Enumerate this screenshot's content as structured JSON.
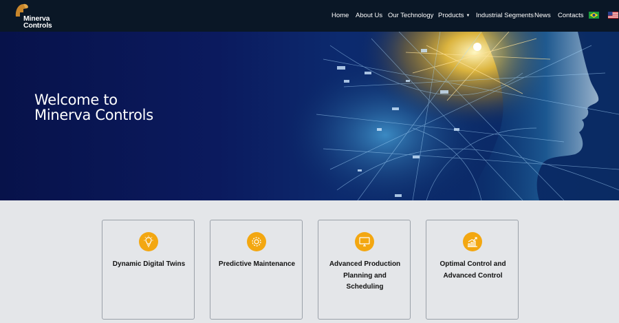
{
  "brand": {
    "line1": "Minerva",
    "line2": "Controls"
  },
  "nav": {
    "items": [
      {
        "label": "Home"
      },
      {
        "label": "About Us"
      },
      {
        "label": "Our Technology"
      },
      {
        "label": "Products"
      },
      {
        "label": "Industrial Segments"
      },
      {
        "label": "News"
      },
      {
        "label": "Contacts"
      }
    ],
    "flags": [
      "brazil-flag-icon",
      "usa-flag-icon"
    ]
  },
  "hero": {
    "title_line1": "Welcome to",
    "title_line2": "Minerva Controls"
  },
  "cards": [
    {
      "title": "Dynamic Digital Twins",
      "icon": "lightbulb-icon"
    },
    {
      "title": "Predictive Maintenance",
      "icon": "gear-icon"
    },
    {
      "title": "Advanced Production Planning and Scheduling",
      "icon": "monitor-icon"
    },
    {
      "title": "Optimal Control and Advanced Control",
      "icon": "chart-up-icon"
    }
  ],
  "colors": {
    "header": "#0a1726",
    "accent": "#f3a711",
    "cards_bg": "#e4e6e9",
    "hero": "#07124a"
  }
}
